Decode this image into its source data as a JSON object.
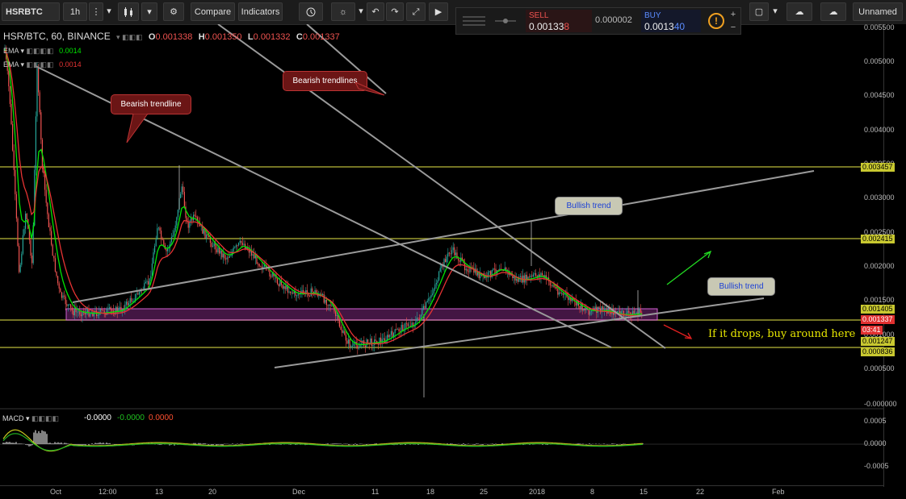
{
  "toolbar": {
    "symbol": "HSRBTC",
    "interval": "1h",
    "compare": "Compare",
    "indicators": "Indicators",
    "layout_name": "Unnamed"
  },
  "order_panel": {
    "sell_label": "SELL",
    "sell_price_main": "0.00133",
    "sell_price_tail": "8",
    "spread": "0.000002",
    "buy_label": "BUY",
    "buy_price_main": "0.0013",
    "buy_price_tail": "40"
  },
  "legend": {
    "title": "HSR/BTC, 60, BINANCE",
    "open_label": "O",
    "open": "0.001338",
    "high_label": "H",
    "high": "0.001350",
    "low_label": "L",
    "low": "0.001332",
    "close_label": "C",
    "close": "0.001337",
    "ema1_label": "EMA",
    "ema1_value": "0.0014",
    "ema2_label": "EMA",
    "ema2_value": "0.0014"
  },
  "annotations": {
    "bearish_trendline": "Bearish trendline",
    "bearish_trendlines": "Bearish trendlines",
    "bullish_trend_1": "Bullish trend",
    "bullish_trend_2": "Bullish trend",
    "buy_note": "If it drops, buy around here"
  },
  "price_scale": {
    "ticks": [
      "0.005500",
      "0.005000",
      "0.004500",
      "0.004000",
      "0.003500",
      "0.003000",
      "0.002500",
      "0.002000",
      "0.001500",
      "0.001000",
      "0.000500",
      "-0.000000"
    ],
    "level_labels": [
      "0.003457",
      "0.002415",
      "0.001405",
      "0.001337",
      "03:41",
      "0.001247",
      "0.000836"
    ]
  },
  "time_axis": {
    "labels": [
      "Oct",
      "12:00",
      "13",
      "20",
      "Dec",
      "11",
      "18",
      "25",
      "2018",
      "8",
      "15",
      "22",
      "Feb"
    ]
  },
  "macd": {
    "label": "MACD",
    "v1": "-0.0000",
    "v2": "-0.0000",
    "v3": "0.0000",
    "scale": [
      "0.0005",
      "0.0000",
      "-0.0005"
    ]
  },
  "colors": {
    "up": "#26a69a",
    "down": "#ef5350",
    "ema_green": "#00e600",
    "ema_red": "#e63333",
    "level": "#9a9a30",
    "zone": "#c040c0"
  }
}
